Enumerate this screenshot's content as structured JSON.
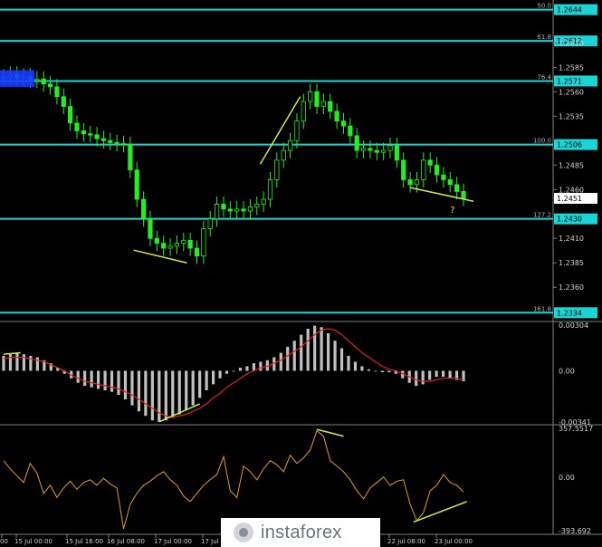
{
  "chart_data": {
    "type": "line",
    "symbol": "GBP/USD",
    "price_ticks": [
      "1.2610",
      "1.2585",
      "1.2560",
      "1.2535",
      "1.2485",
      "1.2460",
      "1.2410",
      "1.2385",
      "1.2360"
    ],
    "fib_levels": [
      {
        "ratio": "50.0",
        "price": 1.2644,
        "label": "1.2644"
      },
      {
        "ratio": "61.8",
        "price": 1.2612,
        "label": "1.2612"
      },
      {
        "ratio": "76.4",
        "price": 1.2571,
        "label": "1.2571"
      },
      {
        "ratio": "100.0",
        "price": 1.2506,
        "label": "1.2506"
      },
      {
        "ratio": "127.2",
        "price": 1.243,
        "label": "1.2430"
      },
      {
        "ratio": "161.8",
        "price": 1.2334,
        "label": "1.2334"
      }
    ],
    "current_price": "1.2451",
    "question_mark": "?",
    "x_labels": [
      "00",
      "15 Jul 00:00",
      "15 Jul 16:00",
      "16 Jul 08:00",
      "17 Jul 00:00",
      "17 Jul",
      "22 Jul 08:00",
      "23 Jul 00:00"
    ],
    "price_series": [
      1.2575,
      1.2578,
      1.2574,
      1.2576,
      1.2572,
      1.2573,
      1.2568,
      1.2565,
      1.2555,
      1.2545,
      1.2528,
      1.252,
      1.2517,
      1.2516,
      1.2512,
      1.251,
      1.2508,
      1.2507,
      1.2506,
      1.248,
      1.245,
      1.243,
      1.241,
      1.2405,
      1.24,
      1.2402,
      1.2405,
      1.2408,
      1.24,
      1.2392,
      1.242,
      1.243,
      1.2445,
      1.244,
      1.2438,
      1.244,
      1.2438,
      1.2442,
      1.2445,
      1.245,
      1.247,
      1.249,
      1.25,
      1.251,
      1.253,
      1.255,
      1.256,
      1.2545,
      1.255,
      1.254,
      1.253,
      1.2525,
      1.2515,
      1.25,
      1.2502,
      1.25,
      1.2498,
      1.25,
      1.2505,
      1.249,
      1.247,
      1.2465,
      1.247,
      1.249,
      1.2485,
      1.2475,
      1.247,
      1.2465,
      1.2458,
      1.2451
    ],
    "macd": {
      "ticks": [
        "0.00304",
        "0.00",
        "-0.00341"
      ],
      "ylim": [
        -0.00341,
        0.00304
      ],
      "histogram": [
        0.001,
        0.0011,
        0.0012,
        0.0011,
        0.001,
        0.0009,
        0.0007,
        0.0005,
        0.0002,
        -0.0002,
        -0.0005,
        -0.0008,
        -0.001,
        -0.0011,
        -0.0012,
        -0.0013,
        -0.0014,
        -0.0016,
        -0.0019,
        -0.0023,
        -0.0027,
        -0.003,
        -0.0033,
        -0.0034,
        -0.0033,
        -0.0031,
        -0.0029,
        -0.0026,
        -0.0023,
        -0.0018,
        -0.0013,
        -0.0009,
        -0.0005,
        -0.0002,
        0.0,
        0.0002,
        0.0003,
        0.0005,
        0.0006,
        0.0007,
        0.0009,
        0.0012,
        0.0016,
        0.002,
        0.0024,
        0.0028,
        0.003,
        0.0029,
        0.0025,
        0.002,
        0.0015,
        0.001,
        0.0006,
        0.0003,
        0.0001,
        0.0,
        -0.0001,
        -0.0001,
        -0.0002,
        -0.0005,
        -0.0008,
        -0.001,
        -0.0009,
        -0.0006,
        -0.0004,
        -0.0004,
        -0.0005,
        -0.0006,
        -0.0007
      ],
      "signal": [
        0.0008,
        0.0009,
        0.0009,
        0.0009,
        0.0008,
        0.0007,
        0.0006,
        0.0004,
        0.0002,
        0.0,
        -0.0003,
        -0.0005,
        -0.0007,
        -0.0008,
        -0.0009,
        -0.001,
        -0.0011,
        -0.0012,
        -0.0014,
        -0.0016,
        -0.0019,
        -0.0022,
        -0.0025,
        -0.0028,
        -0.003,
        -0.0031,
        -0.003,
        -0.0029,
        -0.0027,
        -0.0025,
        -0.0022,
        -0.0018,
        -0.0015,
        -0.0011,
        -0.0008,
        -0.0005,
        -0.0002,
        0.0,
        0.0002,
        0.0003,
        0.0005,
        0.0007,
        0.001,
        0.0013,
        0.0016,
        0.002,
        0.0024,
        0.0027,
        0.0028,
        0.0027,
        0.0024,
        0.002,
        0.0016,
        0.0012,
        0.0009,
        0.0006,
        0.0003,
        0.0001,
        0.0,
        -0.0002,
        -0.0004,
        -0.0006,
        -0.0007,
        -0.0007,
        -0.0006,
        -0.0005,
        -0.0005,
        -0.0005,
        -0.0006
      ]
    },
    "cci": {
      "ticks": [
        "357.5517",
        "0.00",
        "-393.692"
      ],
      "ylim": [
        -393.692,
        357.5517
      ],
      "values": [
        120,
        60,
        10,
        -40,
        100,
        30,
        -120,
        -60,
        -150,
        -80,
        -30,
        -90,
        -40,
        -20,
        -60,
        -10,
        -50,
        -80,
        -380,
        -200,
        -120,
        -60,
        -30,
        10,
        40,
        -20,
        -60,
        -140,
        -180,
        -120,
        -60,
        -20,
        20,
        150,
        -100,
        -150,
        80,
        40,
        -20,
        60,
        120,
        90,
        40,
        160,
        100,
        140,
        200,
        340,
        300,
        120,
        80,
        40,
        -20,
        -100,
        -160,
        -80,
        -40,
        0,
        -60,
        -30,
        -20,
        -200,
        -320,
        -260,
        -100,
        -60,
        20,
        -40,
        -60,
        -110
      ],
      "divergence": [
        -330,
        -180
      ]
    }
  },
  "colors": {
    "background": "#000000",
    "level": "#19d5d5",
    "candle": "#22ee22",
    "trend": "#c8f040",
    "histogram": "#c0c0c0",
    "signal": "#e02020",
    "cci": "#e0a020",
    "axis_text": "#d0d0d0",
    "highlight": "#1a3bff"
  },
  "watermark": {
    "text": "instaforex",
    "icon": "instaforex-logo-icon"
  }
}
